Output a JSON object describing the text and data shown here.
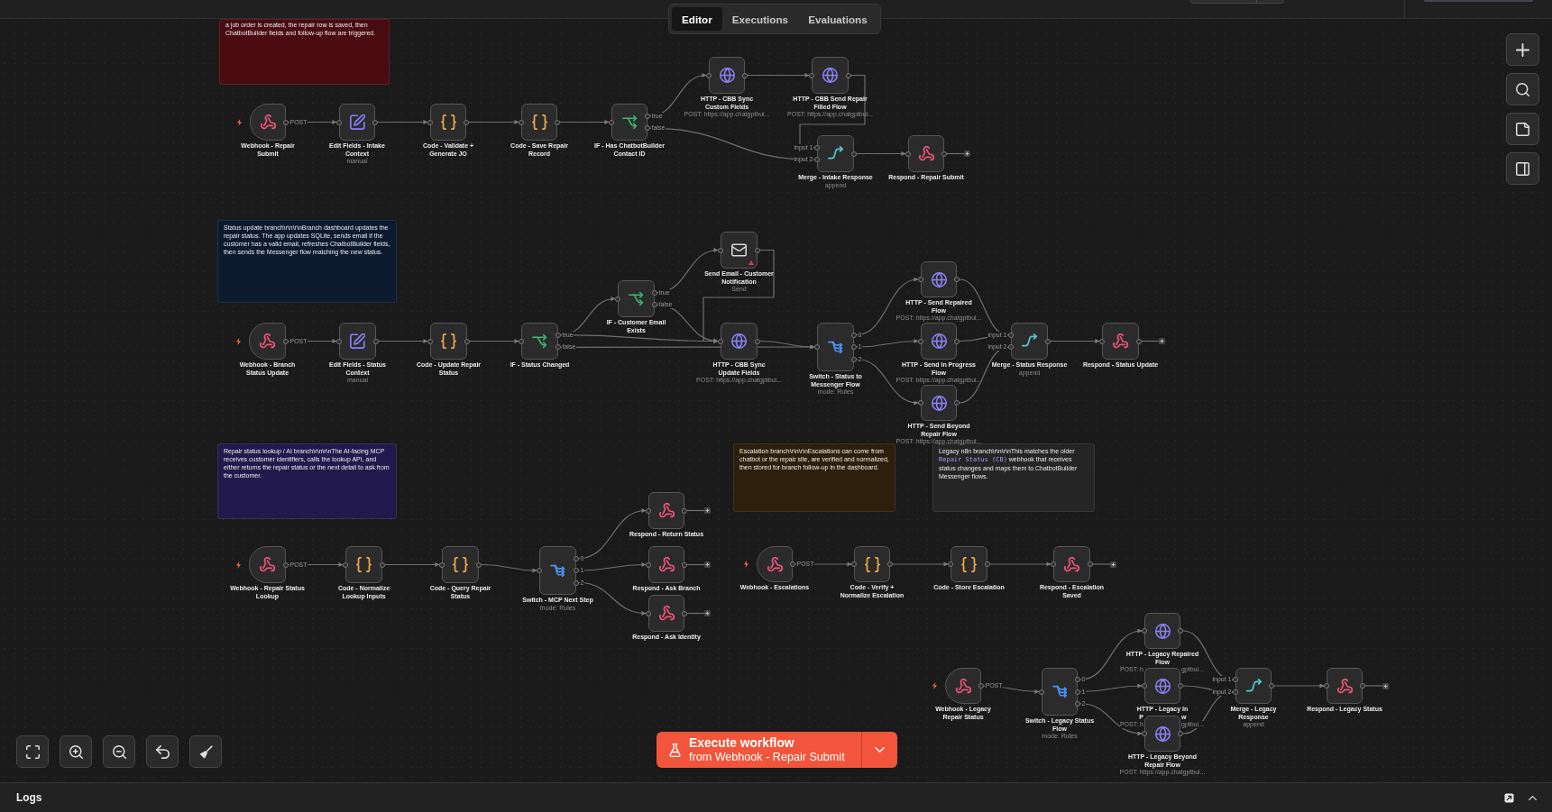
{
  "header": {
    "tabs": [
      {
        "label": "Editor",
        "selected": true
      },
      {
        "label": "Executions",
        "selected": false
      },
      {
        "label": "Evaluations",
        "selected": false
      }
    ]
  },
  "canvas": {
    "sticky_notes": [
      {
        "color": "#4a0b10",
        "parts": [
          {
            "kind": "text",
            "text": "a job order is created, the repair row is saved, then ChatbotBuilder fields and follow-up flow are triggered."
          }
        ]
      },
      {
        "color": "#0c1a2e",
        "parts": [
          {
            "kind": "text",
            "text": "Status update branch\\r\\n\\r\\nBranch dashboard updates the repair status. The app updates SQLite, sends email if the customer has a valid email, refreshes ChatbotBuilder fields, then sends the Messenger flow matching the new status."
          }
        ]
      },
      {
        "color": "#221a4d",
        "parts": [
          {
            "kind": "text",
            "text": "Repair status lookup / AI branch\\r\\n\\r\\nThe AI-facing MCP receives customer identifiers, calls the lookup API, and either returns the repair status or the next detail to ask from the customer."
          }
        ]
      },
      {
        "color": "#2d1f0b",
        "parts": [
          {
            "kind": "text",
            "text": "Escalation branch\\r\\n\\r\\nEscalations can come from chatbot or the repair site, are verified and normalized, then stored for branch follow-up in the dashboard."
          }
        ]
      },
      {
        "color": "#252525",
        "parts": [
          {
            "kind": "text",
            "text": "Legacy n8n branch\\r\\n\\r\\nThis matches the older "
          },
          {
            "kind": "code",
            "text": "Repair Status (CB)"
          },
          {
            "kind": "text",
            "text": " webhook that receives status changes and maps them to ChatbotBuilder Messenger flows."
          }
        ]
      }
    ],
    "nodes": [
      {
        "kind": "webhook",
        "label": "Webhook - Repair Submit",
        "outputs": [
          "POST"
        ],
        "warning": false
      },
      {
        "kind": "set",
        "label": "Edit Fields - Intake Context",
        "subtitle": "manual",
        "warning": false
      },
      {
        "kind": "code",
        "label": "Code - Validate + Generate JO",
        "warning": false
      },
      {
        "kind": "code",
        "label": "Code - Save Repair Record",
        "warning": false
      },
      {
        "kind": "if",
        "label": "IF - Has ChatbotBuilder Contact ID",
        "outputs": [
          "true",
          "false"
        ],
        "warning": false
      },
      {
        "kind": "http",
        "label": "HTTP - CBB Sync Custom Fields",
        "subtitle": "POST: https://app.chatgptbui...",
        "warning": false
      },
      {
        "kind": "http",
        "label": "HTTP - CBB Send Repair Filled Flow",
        "subtitle": "POST: https://app.chatgptbui...",
        "warning": false
      },
      {
        "kind": "merge",
        "label": "Merge - Intake Response",
        "subtitle": "append",
        "inputs": [
          "input 1",
          "input 2"
        ],
        "warning": false
      },
      {
        "kind": "respond",
        "label": "Respond - Repair Submit",
        "warning": false
      },
      {
        "kind": "webhook",
        "label": "Webhook - Branch Status Update",
        "outputs": [
          "POST"
        ],
        "warning": false
      },
      {
        "kind": "set",
        "label": "Edit Fields - Status Context",
        "subtitle": "manual",
        "warning": false
      },
      {
        "kind": "code",
        "label": "Code - Update Repair Status",
        "warning": false
      },
      {
        "kind": "if",
        "label": "IF - Status Changed",
        "outputs": [
          "true",
          "false"
        ],
        "warning": false
      },
      {
        "kind": "if",
        "label": "IF - Customer Email Exists",
        "outputs": [
          "true",
          "false"
        ],
        "warning": false
      },
      {
        "kind": "email",
        "label": "Send Email - Customer Notification",
        "subtitle": "Send",
        "warning": true
      },
      {
        "kind": "http",
        "label": "HTTP - CBB Sync Update Fields",
        "subtitle": "POST: https://app.chatgptbui...",
        "warning": false
      },
      {
        "kind": "switch",
        "label": "Switch - Status to Messenger Flow",
        "subtitle": "mode: Rules",
        "outputs": [
          "0",
          "1",
          "2"
        ],
        "warning": false
      },
      {
        "kind": "http",
        "label": "HTTP - Send Repaired Flow",
        "subtitle": "POST: https://app.chatgptbui...",
        "warning": false
      },
      {
        "kind": "http",
        "label": "HTTP - Send In Progress Flow",
        "subtitle": "POST: https://app.chatgptbui...",
        "warning": false
      },
      {
        "kind": "http",
        "label": "HTTP - Send Beyond Repair Flow",
        "subtitle": "POST: https://app.chatgptbui...",
        "warning": false
      },
      {
        "kind": "merge",
        "label": "Merge - Status Response",
        "subtitle": "append",
        "inputs": [
          "input 1",
          "input 2"
        ],
        "warning": false
      },
      {
        "kind": "respond",
        "label": "Respond - Status Update",
        "warning": false
      },
      {
        "kind": "webhook",
        "label": "Webhook - Repair Status Lookup",
        "outputs": [
          "POST"
        ],
        "warning": false
      },
      {
        "kind": "code",
        "label": "Code - Normalize Lookup Inputs",
        "warning": false
      },
      {
        "kind": "code",
        "label": "Code - Query Repair Status",
        "warning": false
      },
      {
        "kind": "switch",
        "label": "Switch - MCP Next Step",
        "subtitle": "mode: Rules",
        "outputs": [
          "0",
          "1",
          "2"
        ],
        "warning": false
      },
      {
        "kind": "respond",
        "label": "Respond - Return Status",
        "warning": false
      },
      {
        "kind": "respond",
        "label": "Respond - Ask Branch",
        "warning": false
      },
      {
        "kind": "respond",
        "label": "Respond - Ask Identity",
        "warning": false
      },
      {
        "kind": "webhook",
        "label": "Webhook - Escalations",
        "outputs": [
          "POST"
        ],
        "warning": false
      },
      {
        "kind": "code",
        "label": "Code - Verify + Normalize Escalation",
        "warning": false
      },
      {
        "kind": "code",
        "label": "Code - Store Escalation",
        "warning": false
      },
      {
        "kind": "respond",
        "label": "Respond - Escalation Saved",
        "warning": false
      },
      {
        "kind": "webhook",
        "label": "Webhook - Legacy Repair Status",
        "outputs": [
          "POST"
        ],
        "warning": false
      },
      {
        "kind": "switch",
        "label": "Switch - Legacy Status Flow",
        "subtitle": "mode: Rules",
        "outputs": [
          "0",
          "1",
          "2"
        ],
        "warning": false
      },
      {
        "kind": "http",
        "label": "HTTP - Legacy Repaired Flow",
        "covered_subtitle": {
          "left": "POST: h",
          "right": "gptbui..."
        },
        "warning": false
      },
      {
        "kind": "http",
        "label": "HTTP - Legacy In",
        "covered_label_line": {
          "left": "P",
          "right": "w"
        },
        "covered_subtitle": {
          "left": "POST: h",
          "right": "gptbui..."
        },
        "warning": false
      },
      {
        "kind": "http",
        "label": "HTTP - Legacy Beyond Repair Flow",
        "subtitle": "POST: https://app.chatgptbui...",
        "warning": false
      },
      {
        "kind": "merge",
        "label": "Merge - Legacy Response",
        "subtitle": "append",
        "inputs": [
          "input 1",
          "input 2"
        ],
        "warning": false
      },
      {
        "kind": "respond",
        "label": "Respond - Legacy Status",
        "warning": false
      }
    ]
  },
  "execute_button": {
    "label": "Execute workflow",
    "trigger": "from Webhook - Repair Submit"
  },
  "logs_panel": {
    "title": "Logs"
  }
}
